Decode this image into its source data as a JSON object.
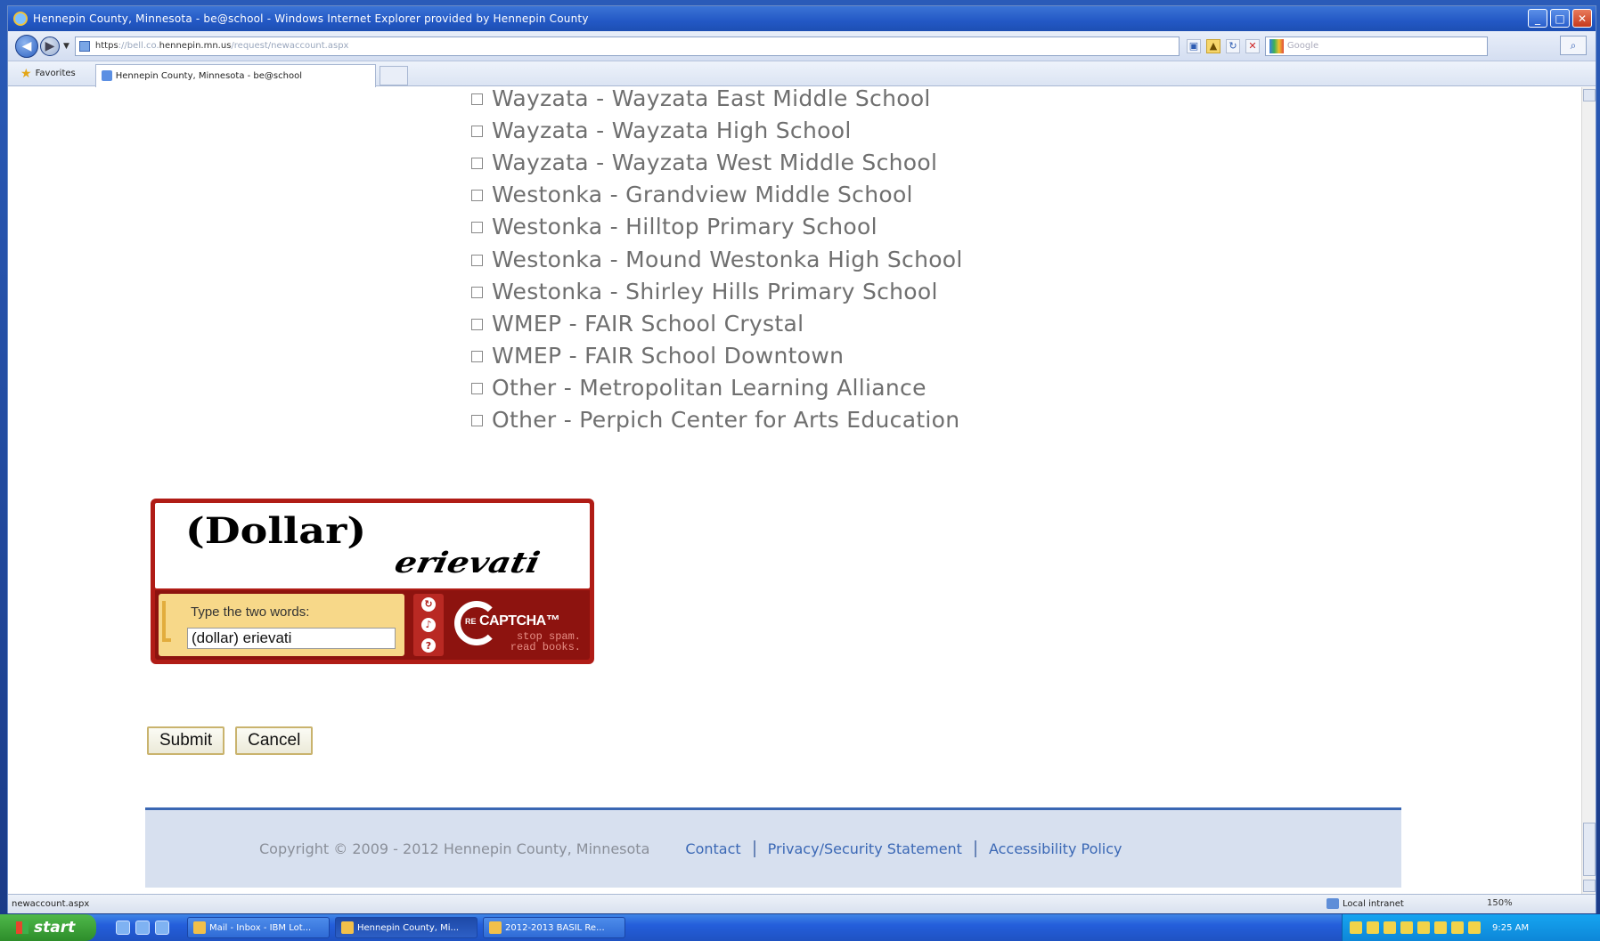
{
  "window": {
    "title": "Hennepin County, Minnesota - be@school - Windows Internet Explorer provided by Hennepin County"
  },
  "address": {
    "url_prefix": "https",
    "url_faded1": "://bell.co.",
    "url_domain": "hennepin.mn.us",
    "url_faded2": "/request/newaccount.aspx"
  },
  "search": {
    "placeholder": "Google"
  },
  "favorites": {
    "label": "Favorites",
    "tab_title": "Hennepin County, Minnesota - be@school"
  },
  "schools": [
    "Wayzata - Wayzata East Middle School",
    "Wayzata - Wayzata High School",
    "Wayzata - Wayzata West Middle School",
    "Westonka - Grandview Middle School",
    "Westonka - Hilltop Primary School",
    "Westonka - Mound Westonka High School",
    "Westonka - Shirley Hills Primary School",
    "WMEP - FAIR School Crystal",
    "WMEP - FAIR School Downtown",
    "Other - Metropolitan Learning Alliance",
    "Other - Perpich Center for Arts Education"
  ],
  "captcha": {
    "word1": "(Dollar)",
    "word2": "erievati",
    "prompt": "Type the two words:",
    "input_value": "(dollar) erievati",
    "brand_re": "RE",
    "brand_name": "CAPTCHA™",
    "tagline1": "stop spam.",
    "tagline2": "read books."
  },
  "buttons": {
    "submit": "Submit",
    "cancel": "Cancel"
  },
  "footer": {
    "copyright": "Copyright © 2009 - 2012  Hennepin County, Minnesota",
    "links": [
      "Contact",
      "Privacy/Security Statement",
      "Accessibility Policy"
    ]
  },
  "status": {
    "left": "newaccount.aspx",
    "zone": "Local intranet",
    "zoom": "150%"
  },
  "taskbar": {
    "start": "start",
    "tasks": [
      "Mail - Inbox - IBM Lot...",
      "Hennepin County, Mi...",
      "2012-2013 BASIL Re..."
    ],
    "clock": "9:25 AM"
  },
  "colors": {
    "link": "#3b68b5",
    "captcha_red": "#b01c16",
    "footer_bg": "#d7e0ef"
  }
}
